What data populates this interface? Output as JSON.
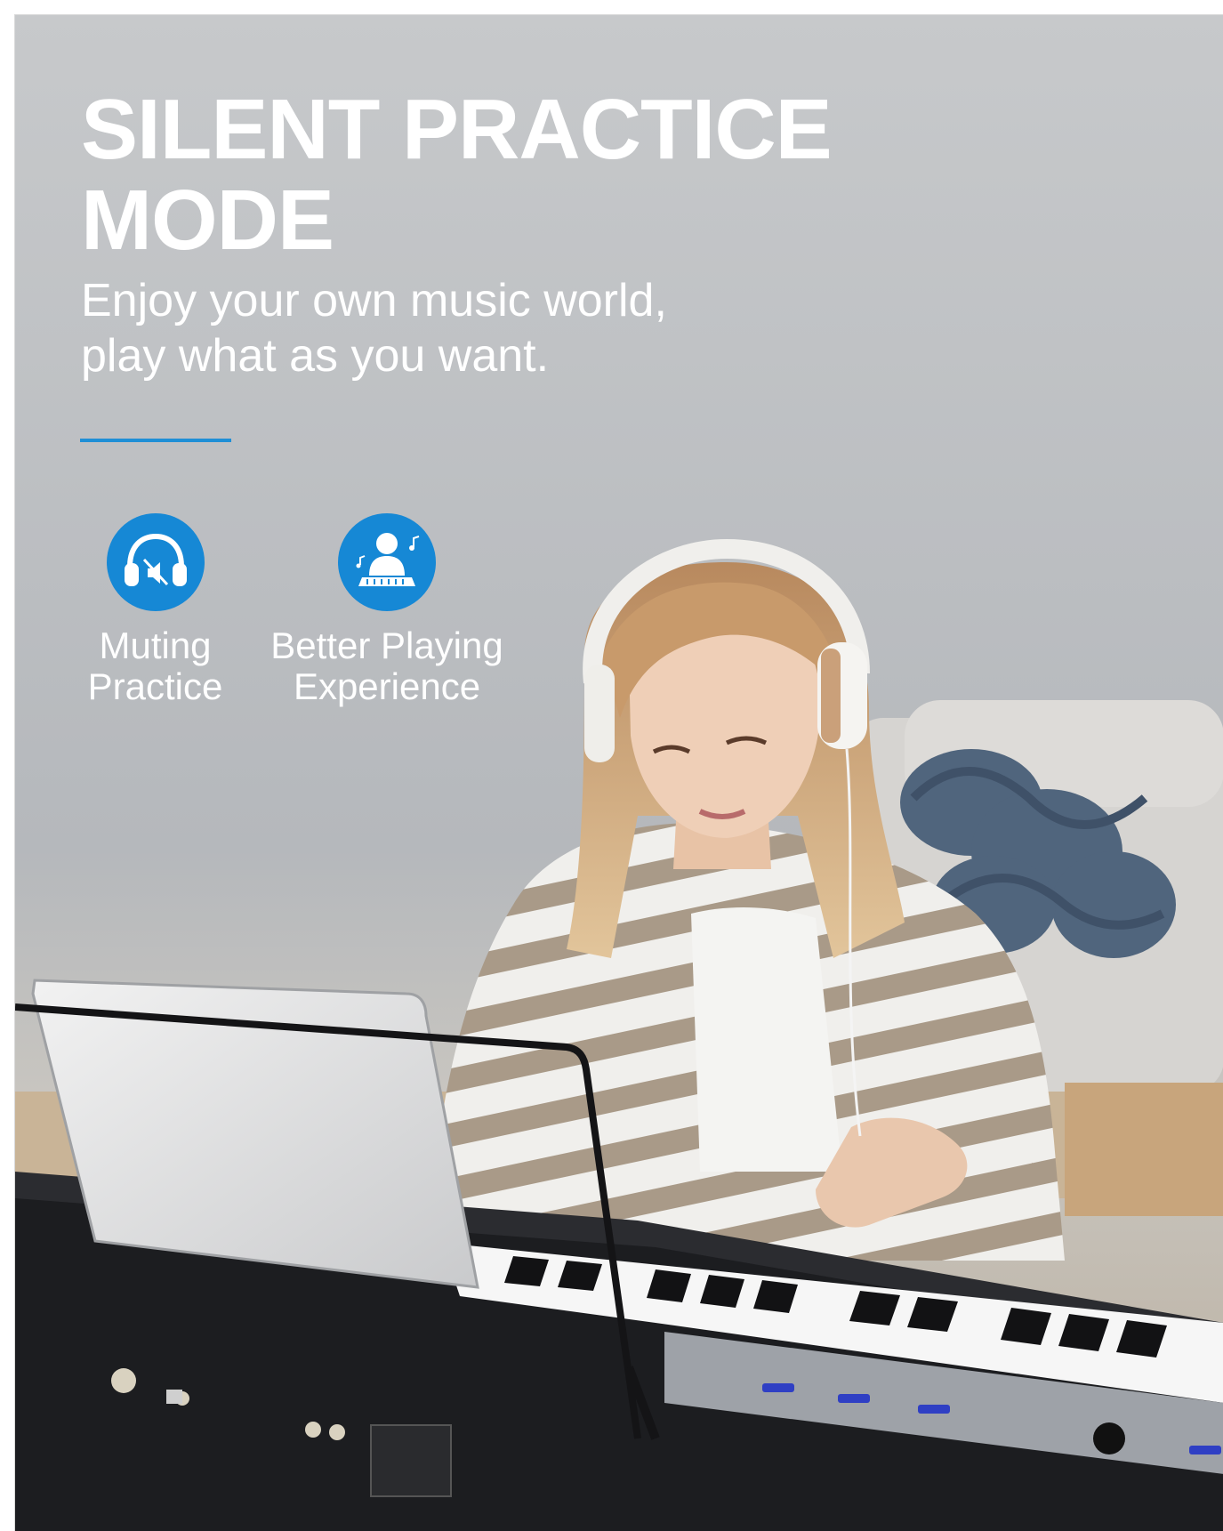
{
  "headline": {
    "line1": "SILENT PRACTICE",
    "line2": "MODE"
  },
  "subline": {
    "line1": "Enjoy your own music world,",
    "line2": "play what as you want."
  },
  "features": [
    {
      "icon": "headphones-muted-icon",
      "line1": "Muting",
      "line2": "Practice"
    },
    {
      "icon": "person-playing-piano-icon",
      "line1": "Better Playing",
      "line2": "Experience"
    }
  ],
  "colors": {
    "accent": "#1688d5",
    "text": "#ffffff"
  }
}
